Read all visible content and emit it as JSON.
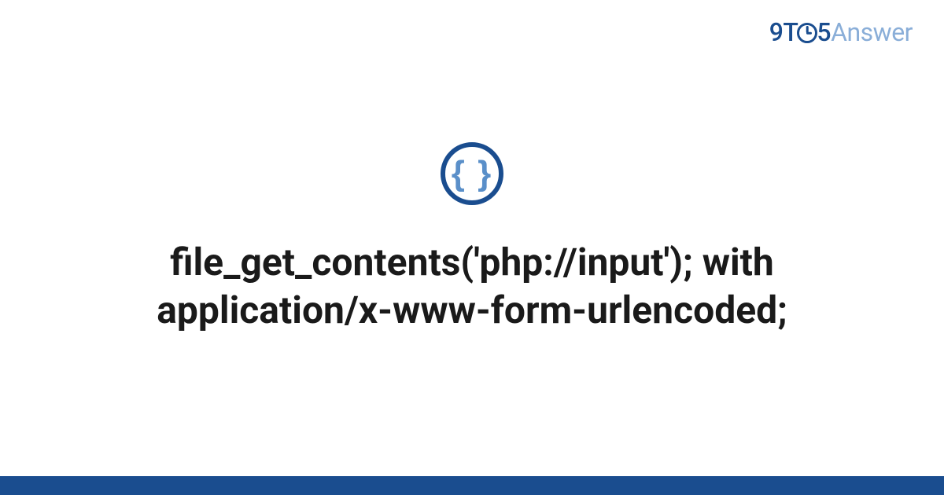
{
  "brand": {
    "part1": "9T",
    "part2": "5",
    "part3": "Answer"
  },
  "icon": {
    "name": "code-braces-icon",
    "glyph": "{ }"
  },
  "title": "file_get_contents('php://input'); with application/x-www-form-urlencoded;",
  "colors": {
    "primary": "#1a4d8f",
    "secondary": "#8aaed8",
    "icon_inner": "#5a8fc9",
    "text": "#1a1a1a",
    "background": "#ffffff"
  }
}
